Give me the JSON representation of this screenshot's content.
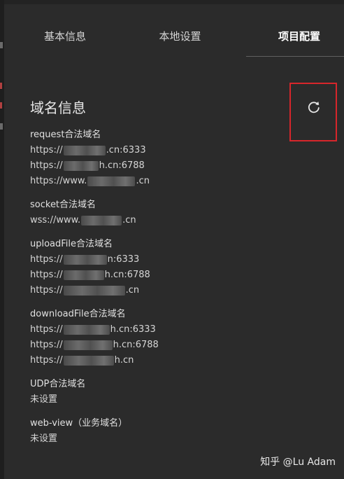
{
  "tabs": [
    "基本信息",
    "本地设置",
    "项目配置"
  ],
  "active_tab_index": 2,
  "section": {
    "title": "域名信息",
    "refresh_icon": "refresh-icon"
  },
  "groups": [
    {
      "title": "request合法域名",
      "lines": [
        {
          "prefix": "https://",
          "suffix": ".cn:6333"
        },
        {
          "prefix": "https://",
          "suffix": "h.cn:6788"
        },
        {
          "prefix": "https://www.",
          "suffix": ".cn"
        }
      ]
    },
    {
      "title": "socket合法域名",
      "lines": [
        {
          "prefix": "wss://www.",
          "suffix": ".cn"
        }
      ]
    },
    {
      "title": "uploadFile合法域名",
      "lines": [
        {
          "prefix": "https://",
          "suffix": "n:6333"
        },
        {
          "prefix": "https://",
          "suffix": "h.cn:6788"
        },
        {
          "prefix": "https://",
          "suffix": ".cn"
        }
      ]
    },
    {
      "title": "downloadFile合法域名",
      "lines": [
        {
          "prefix": "https://",
          "suffix": "h.cn:6333"
        },
        {
          "prefix": "https://",
          "suffix": "h.cn:6788"
        },
        {
          "prefix": "https://",
          "suffix": "h.cn"
        }
      ]
    },
    {
      "title": "UDP合法域名",
      "lines": [
        {
          "prefix": "未设置",
          "suffix": ""
        }
      ]
    },
    {
      "title": "web-view（业务域名）",
      "lines": [
        {
          "prefix": "未设置",
          "suffix": ""
        }
      ]
    }
  ],
  "watermark": "知乎 @Lu Adam",
  "colors": {
    "background": "#2b2b2b",
    "highlight_box": "#d7262b"
  }
}
